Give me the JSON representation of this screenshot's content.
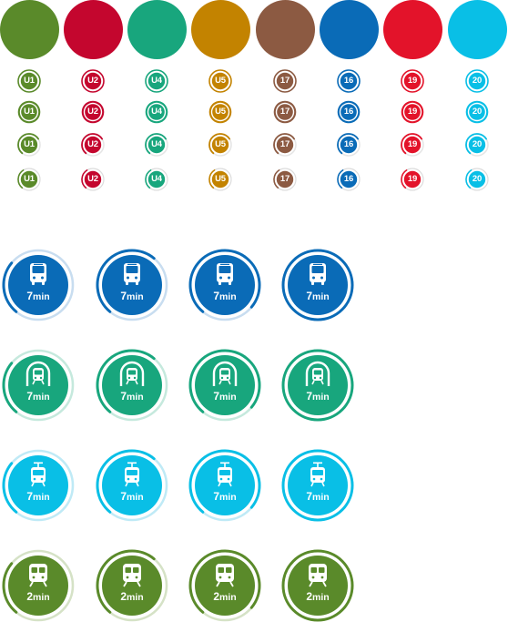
{
  "palette": [
    {
      "name": "olive-green",
      "color": "#5A8A2A"
    },
    {
      "name": "crimson",
      "color": "#C4062E"
    },
    {
      "name": "teal",
      "color": "#18A67D"
    },
    {
      "name": "amber",
      "color": "#C38300"
    },
    {
      "name": "brown",
      "color": "#8C5A42"
    },
    {
      "name": "blue",
      "color": "#0A6BB7"
    },
    {
      "name": "red",
      "color": "#E3132A"
    },
    {
      "name": "cyan",
      "color": "#09BFE6"
    }
  ],
  "line_badges": [
    "U1",
    "U2",
    "U4",
    "U5",
    "17",
    "16",
    "19",
    "20"
  ],
  "badge_variants": [
    "ring-thin",
    "ring-double",
    "ring-partial",
    "ring-outline-thin"
  ],
  "tile_rows": [
    {
      "mode": "bus",
      "icon": "bus-icon",
      "color": "#0A6BB7",
      "light": "#C8DDF0",
      "time": "7",
      "unit": "min"
    },
    {
      "mode": "subway",
      "icon": "subway-icon",
      "color": "#18A67D",
      "light": "#C5E9DD",
      "time": "7",
      "unit": "min"
    },
    {
      "mode": "tram",
      "icon": "tram-icon",
      "color": "#09BFE6",
      "light": "#BFEAF6",
      "time": "7",
      "unit": "min"
    },
    {
      "mode": "train",
      "icon": "train-icon",
      "color": "#5A8A2A",
      "light": "#D5E2C6",
      "time": "2",
      "unit": "min"
    }
  ],
  "tile_progress": [
    0.25,
    0.5,
    0.75,
    1.0
  ]
}
